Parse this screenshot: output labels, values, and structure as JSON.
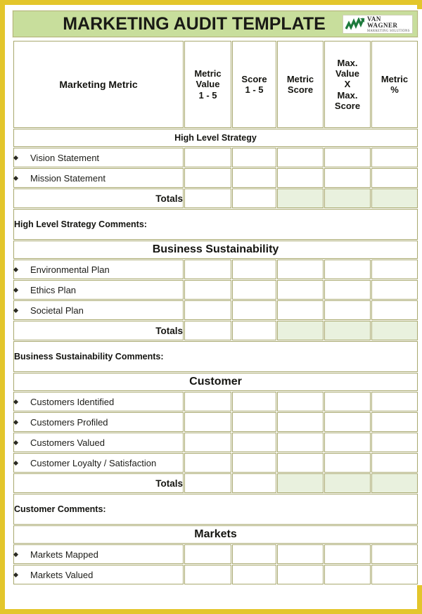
{
  "title": "MARKETING AUDIT TEMPLATE",
  "logo": {
    "name": "VAN WAGNER",
    "tagline": "MARKETING SOLUTIONS",
    "mark": "upward-trend-arrow-icon",
    "color": "#1d7a3c"
  },
  "colors": {
    "page_border": "#e3c62c",
    "title_bar": "#c8de9c",
    "section_band": "#dde9c5",
    "header_band": "#dce9c4",
    "cell_border": "#a8a86e",
    "totals_fill": "#e9f1de",
    "text": "#141410"
  },
  "columns": [
    "Marketing Metric",
    "Metric Value 1 - 5",
    "Score 1 - 5",
    "Metric Score",
    "Max. Value X Max. Score",
    "Metric %"
  ],
  "column_lines": {
    "metric_value": [
      "Metric",
      "Value",
      "1 - 5"
    ],
    "score": [
      "Score",
      "1 - 5"
    ],
    "metric_score": [
      "Metric",
      "Score"
    ],
    "max_value": [
      "Max.",
      "Value",
      "X",
      "Max.",
      "Score"
    ],
    "metric_pct": [
      "Metric",
      "%"
    ]
  },
  "totals_label": "Totals",
  "sections": [
    {
      "name": "High Level Strategy",
      "style": "small",
      "rows": [
        "Vision Statement",
        "Mission Statement"
      ],
      "has_totals": true,
      "comments_label": "High Level Strategy Comments:"
    },
    {
      "name": "Business Sustainability",
      "style": "big",
      "rows": [
        "Environmental Plan",
        "Ethics Plan",
        "Societal Plan"
      ],
      "has_totals": true,
      "comments_label": "Business Sustainability Comments:"
    },
    {
      "name": "Customer",
      "style": "big",
      "rows": [
        "Customers Identified",
        "Customers Profiled",
        "Customers Valued",
        "Customer Loyalty / Satisfaction"
      ],
      "has_totals": true,
      "comments_label": "Customer Comments:"
    },
    {
      "name": "Markets",
      "style": "big",
      "rows": [
        "Markets Mapped",
        "Markets Valued"
      ],
      "has_totals": false,
      "comments_label": null
    }
  ]
}
